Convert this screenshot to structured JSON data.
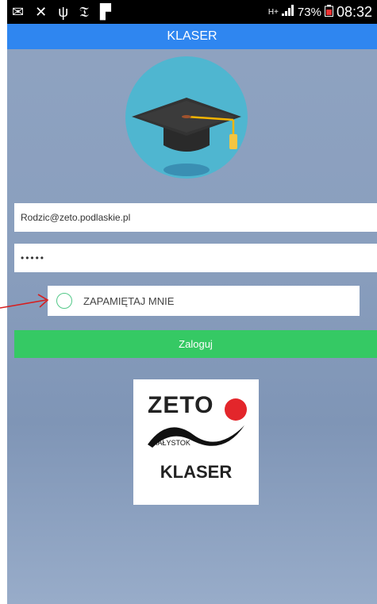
{
  "status_bar": {
    "battery": "73%",
    "time": "08:32"
  },
  "app_bar": {
    "title": "KLASER"
  },
  "login_form": {
    "email_value": "Rodzic@zeto.podlaskie.pl",
    "password_value": "•••••",
    "remember_label": "ZAPAMIĘTAJ MNIE",
    "remember_checked": false,
    "login_button": "Zaloguj"
  },
  "brand_logo": {
    "word": "ZETO",
    "city": "BIAŁYSTOK",
    "product": "KLASER",
    "dot_color": "#e3262b"
  },
  "colors": {
    "app_bar": "#2f86f0",
    "login_button": "#35c964",
    "logo_circle": "#4fb6d0",
    "annotation_arrow": "#d61f1f"
  }
}
